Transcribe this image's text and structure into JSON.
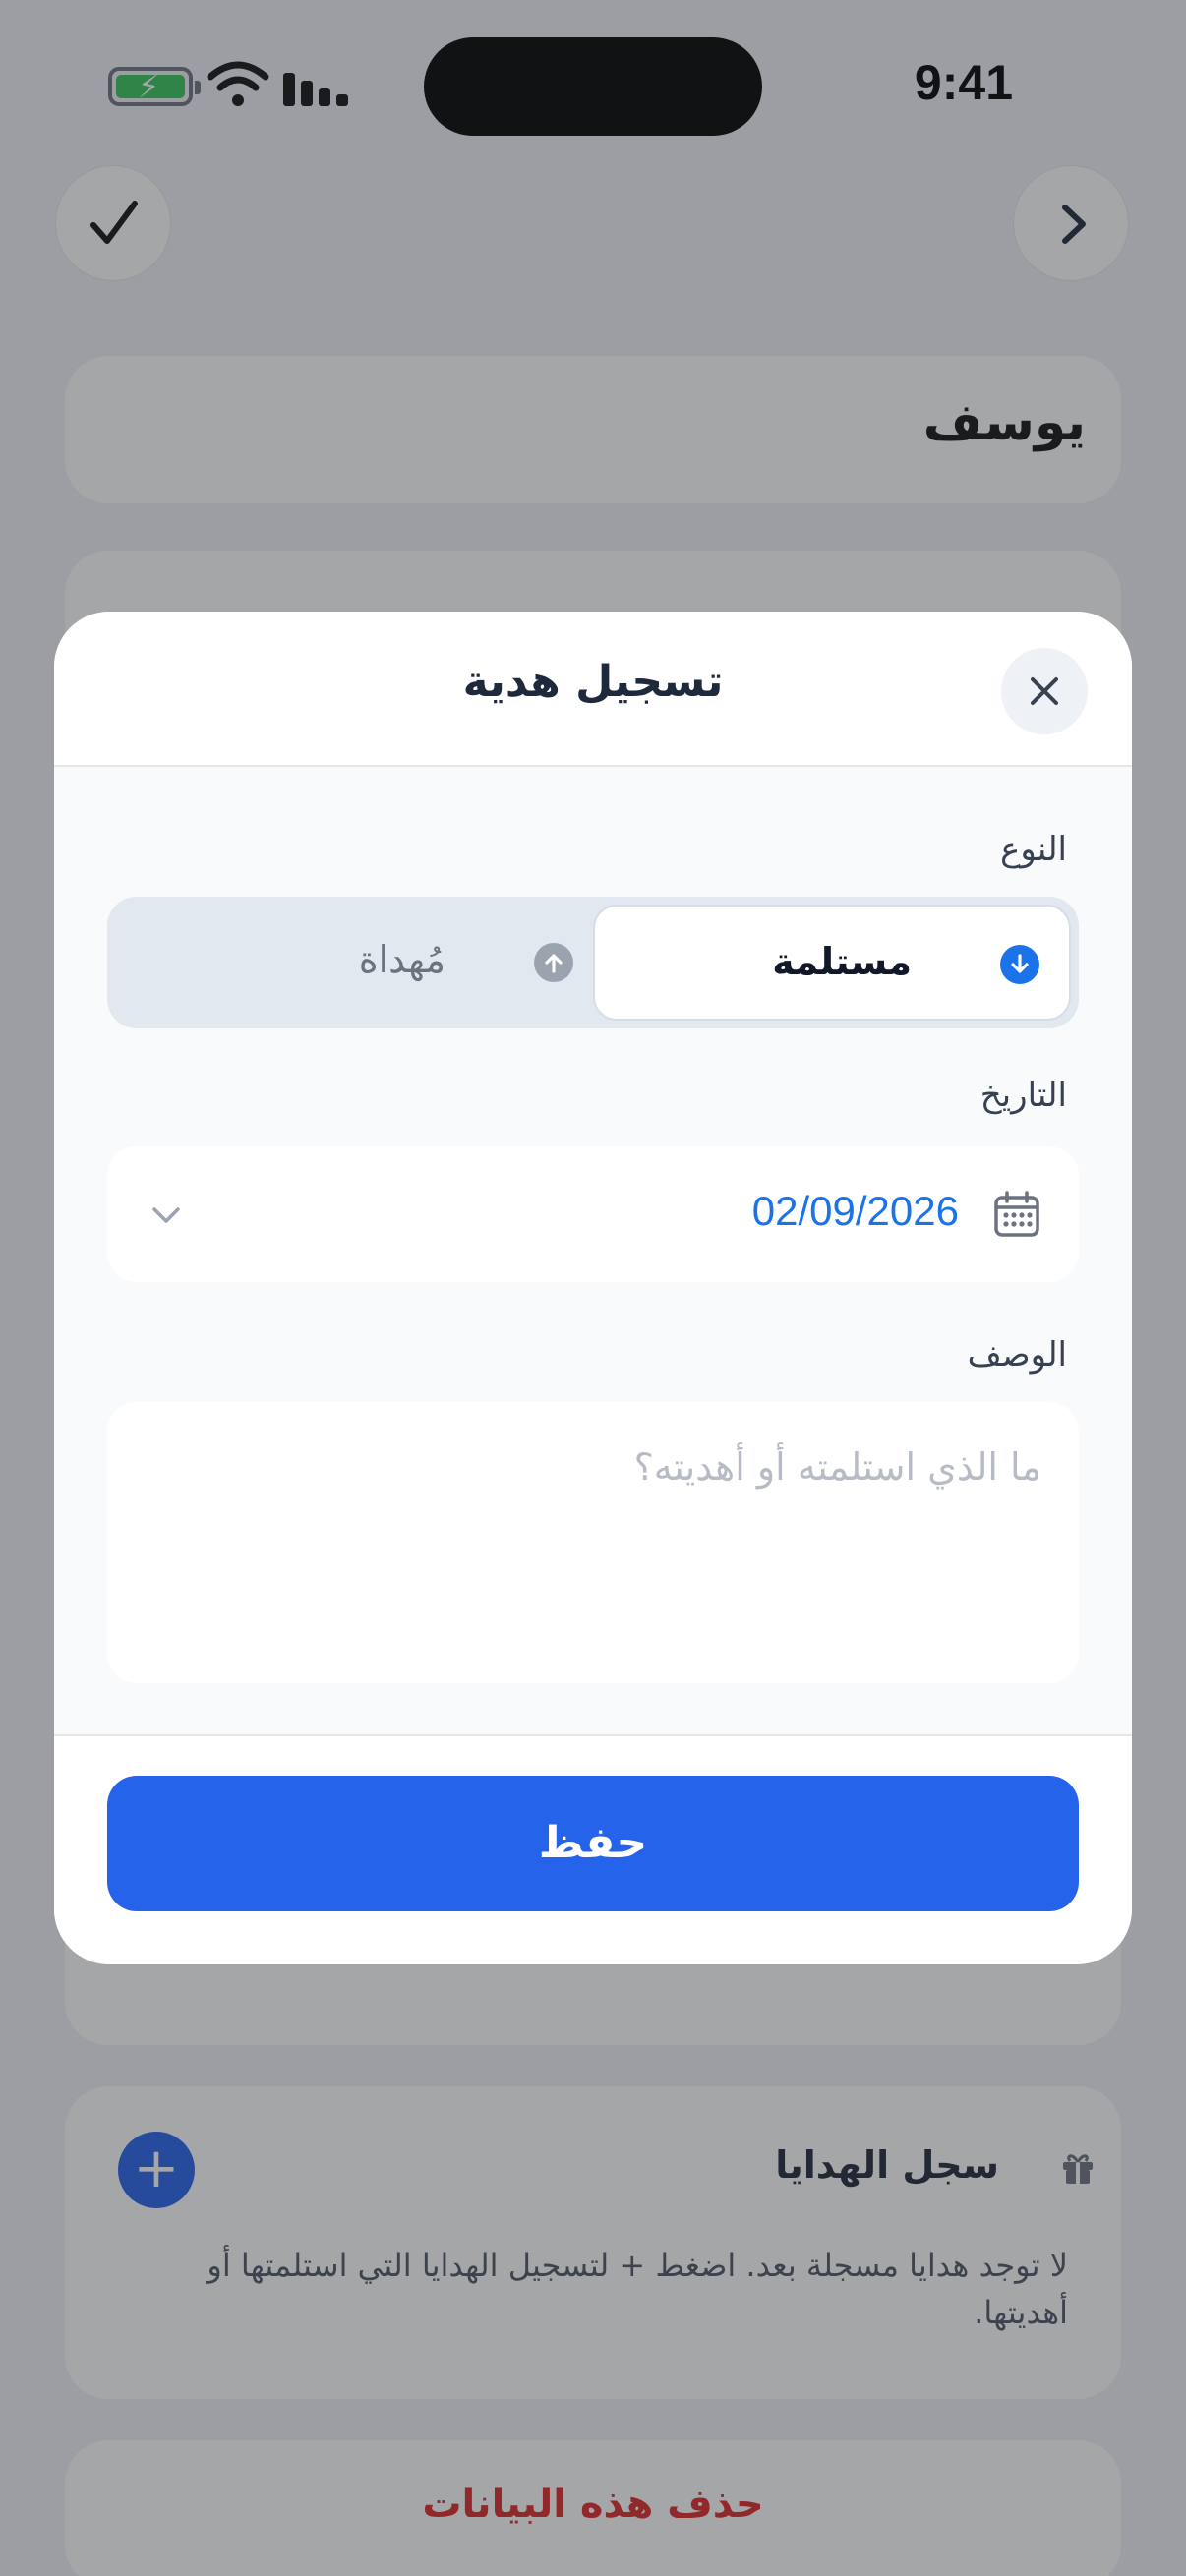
{
  "status_bar": {
    "time": "9:41"
  },
  "page": {
    "name": "يوسف",
    "gifts_section": {
      "title": "سجل الهدايا",
      "add_label": "+",
      "empty_text": "لا توجد هدايا مسجلة بعد. اضغط + لتسجيل الهدايا التي استلمتها أو أهديتها."
    },
    "delete_label": "حذف هذه البيانات"
  },
  "modal": {
    "title": "تسجيل هدية",
    "type_label": "النوع",
    "type_options": [
      {
        "label": "مستلمة",
        "selected": true,
        "icon": "arrow-down-circle-icon"
      },
      {
        "label": "مُهداة",
        "selected": false,
        "icon": "arrow-up-circle-icon"
      }
    ],
    "date_label": "التاريخ",
    "date_value": "02/09/2026",
    "description_label": "الوصف",
    "description_placeholder": "ما الذي استلمته أو أهديته؟",
    "description_value": "",
    "save_label": "حفظ"
  },
  "colors": {
    "accent": "#2563eb",
    "date_text": "#1a73e8",
    "danger": "#dc2626",
    "battery": "#34c759"
  }
}
